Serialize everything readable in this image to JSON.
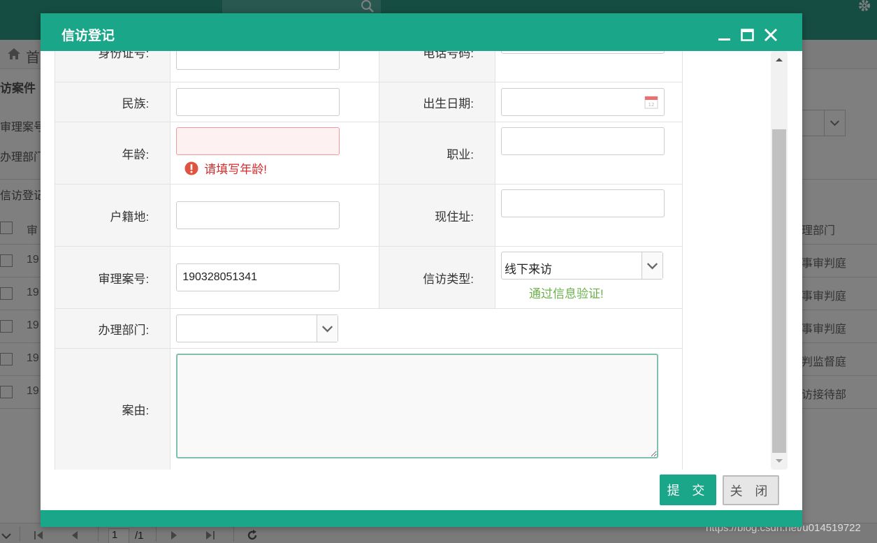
{
  "background": {
    "crumb_text": "首",
    "panel_title": "访案件",
    "filter_label_1": "审理案号",
    "filter_label_2": "办理部门",
    "tab_label": "信访登记",
    "header_col_1": "审",
    "header_col_2": "理部门",
    "rows": [
      {
        "c1": "19",
        "c2": "事审判庭"
      },
      {
        "c1": "19",
        "c2": "事审判庭"
      },
      {
        "c1": "19",
        "c2": "事审判庭"
      },
      {
        "c1": "19",
        "c2": "判监督庭"
      },
      {
        "c1": "19",
        "c2": "访接待部"
      }
    ],
    "pager": {
      "page": "1",
      "total": "/1"
    },
    "watermark": "https://blog.csdn.net/u014519722"
  },
  "dialog": {
    "title": "信访登记",
    "fields": {
      "id_label": "身份证号:",
      "phone_label": "电话号码:",
      "ethnicity_label": "民族:",
      "birth_label": "出生日期:",
      "age_label": "年龄:",
      "age_error": "请填写年龄!",
      "occupation_label": "职业:",
      "household_label": "户籍地:",
      "address_label": "现住址:",
      "case_no_label": "审理案号:",
      "case_no_value": "190328051341",
      "visit_type_label": "信访类型:",
      "visit_type_value": "线下来访",
      "visit_type_ok": "通过信息验证!",
      "dept_label": "办理部门:",
      "reason_label": "案由:"
    },
    "buttons": {
      "submit": "提 交",
      "close": "关 闭"
    },
    "colors": {
      "accent": "#1aa689",
      "error": "#d42c2c",
      "success": "#6ab14a"
    }
  }
}
